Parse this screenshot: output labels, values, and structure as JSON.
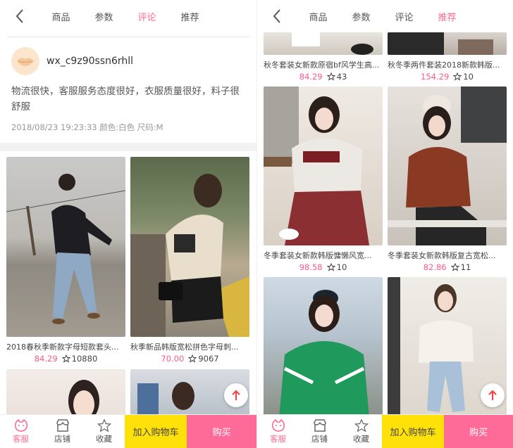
{
  "nav_tabs": [
    "商品",
    "参数",
    "评论",
    "推荐"
  ],
  "left": {
    "active_tab": "评论",
    "review": {
      "username": "wx_c9z90ssn6rhll",
      "text": "物流很快，客服服务态度很好，衣服质量很好，料子很舒服",
      "meta": "2018/08/23 19:23:33   颜色:白色 尺码:M"
    },
    "products": [
      {
        "title": "2018春秋季新款字母短款套头...",
        "price": "84.29",
        "favs": "10880"
      },
      {
        "title": "秋季新品韩版宽松拼色字母刺...",
        "price": "70.00",
        "favs": "9067"
      }
    ]
  },
  "right": {
    "active_tab": "推荐",
    "products": [
      {
        "title": "秋冬套装女新款原宿bf风学生高...",
        "price": "84.29",
        "favs": "43"
      },
      {
        "title": "秋冬季两件套装2018新款韩版...",
        "price": "154.29",
        "favs": "10"
      },
      {
        "title": "冬季套装女新款韩版慵懒风宽...",
        "price": "98.58",
        "favs": "10"
      },
      {
        "title": "冬季套装女新款韩版复古宽松...",
        "price": "82.86",
        "favs": "11"
      }
    ]
  },
  "bottom": {
    "service": "客服",
    "shop": "店铺",
    "collect": "收藏",
    "add_cart": "加入购物车",
    "buy": "购买"
  },
  "icons": [
    "back-arrow-icon",
    "lips-avatar-icon",
    "star-icon",
    "service-face-icon",
    "shop-icon",
    "collect-star-icon",
    "scroll-top-arrow-icon"
  ],
  "colors": {
    "accent": "#ff6b96",
    "cart": "#ffe10a",
    "buy": "#ff6b98",
    "price": "#ff5a8a"
  }
}
